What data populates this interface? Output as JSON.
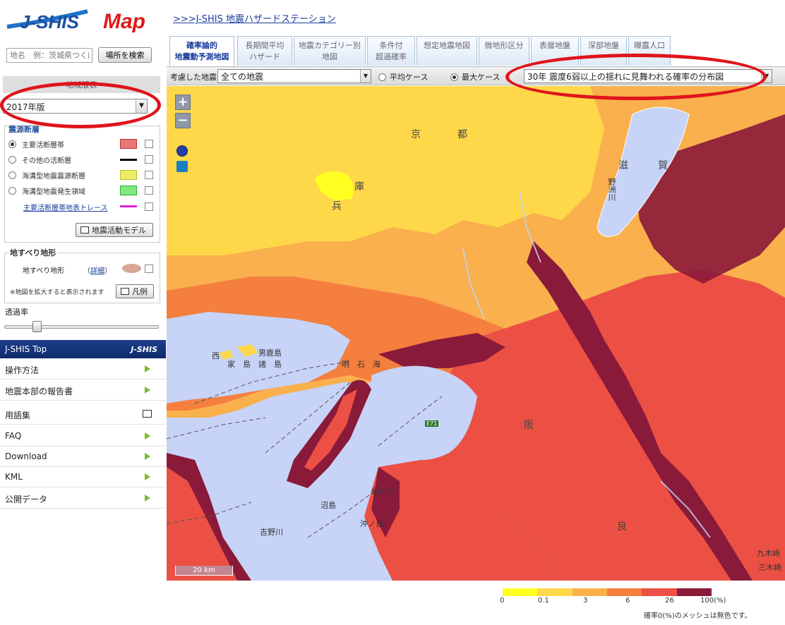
{
  "header": {
    "logo_text": "J-SHIS Map",
    "top_link": ">>>J-SHIS 地震ハザードステーション"
  },
  "search": {
    "placeholder": "地名　例：茨城県つくば市",
    "button": "場所を検索"
  },
  "version": {
    "section_title": "地域版表",
    "selected": "2017年版"
  },
  "faults": {
    "title": "震源断層",
    "layers": [
      {
        "label": "主要活断層帯",
        "selected": true,
        "swatch": "#e87878"
      },
      {
        "label": "その他の活断層",
        "selected": false,
        "swatch": "#000000"
      },
      {
        "label": "海溝型地震震源断層",
        "selected": false,
        "swatch": "#eeee66"
      },
      {
        "label": "海溝型地震発生領域",
        "selected": false,
        "swatch": "#7fe87f"
      }
    ],
    "trace_link": "主要活断層帯地表トレース",
    "trace_color": "#e020e0",
    "model_button": "地震活動モデル"
  },
  "landslide": {
    "title": "地すべり地形",
    "label": "地すべり地形",
    "detail_link": "詳細",
    "swatch": "#d6a796",
    "note": "※地図を拡大すると表示されます",
    "legend_button": "凡例"
  },
  "opacity": {
    "label": "透過率",
    "value": 0.2
  },
  "jshis_top": {
    "title": "J-SHIS Top",
    "logo": "J-SHIS"
  },
  "menu": [
    {
      "label": "操作方法",
      "icon": "arrow-icon"
    },
    {
      "label": "地震本部の報告書",
      "icon": "arrow-icon"
    },
    {
      "label": "用語集",
      "icon": "document-icon"
    },
    {
      "label": "FAQ",
      "icon": "arrow-icon"
    },
    {
      "label": "Download",
      "icon": "arrow-icon"
    },
    {
      "label": "KML",
      "icon": "arrow-icon"
    },
    {
      "label": "公開データ",
      "icon": "arrow-icon"
    }
  ],
  "tabs": [
    {
      "line1": "確率論的",
      "line2": "地震動予測地図",
      "active": true
    },
    {
      "line1": "長期間平均",
      "line2": "ハザード",
      "active": false
    },
    {
      "line1": "地震カテゴリー別",
      "line2": "地図",
      "active": false
    },
    {
      "line1": "条件付",
      "line2": "超過確率",
      "active": false
    },
    {
      "line1": "想定地震地図",
      "line2": "",
      "active": false
    },
    {
      "line1": "微地形区分",
      "line2": "",
      "active": false
    },
    {
      "line1": "表層地盤",
      "line2": "",
      "active": false
    },
    {
      "line1": "深部地盤",
      "line2": "",
      "active": false
    },
    {
      "line1": "曝露人口",
      "line2": "",
      "active": false
    }
  ],
  "toolbar": {
    "eq_label": "考慮した地震",
    "eq_value": "全ての地震",
    "case_avg": "平均ケース",
    "case_max": "最大ケース",
    "case_selected": "max",
    "prob_value": "30年 震度6弱以上の揺れに見舞われる確率の分布図"
  },
  "map": {
    "zoom_in": "+",
    "zoom_out": "−",
    "scale": "20 km",
    "labels": {
      "kyoto1": "京",
      "kyoto2": "都",
      "hyogo1": "兵",
      "hyogo2": "庫",
      "shiga1": "滋",
      "shiga2": "賀",
      "osaka": "阪",
      "nara": "良",
      "akashi": "明　石　海",
      "ieshima": "家　島　諸　島",
      "nishijima": "西",
      "boze": "男鹿島",
      "numashima": "沼島",
      "okinoshima": "沖ノ島",
      "kinokawa": "紀の川",
      "yoshinogawa": "吉野川",
      "kunotaki": "九木崎",
      "sangizaki": "三木崎",
      "yasu": "野洲川",
      "route": "E71"
    }
  },
  "legend": {
    "colors": [
      "#ffff22",
      "#ffd84a",
      "#f9b04d",
      "#f47f3f",
      "#ec5044",
      "#8a1a3a"
    ],
    "ticks": [
      "0",
      "0.1",
      "3",
      "6",
      "26",
      "100(%)"
    ],
    "note": "確率0(%)のメッシュは無色です。"
  }
}
